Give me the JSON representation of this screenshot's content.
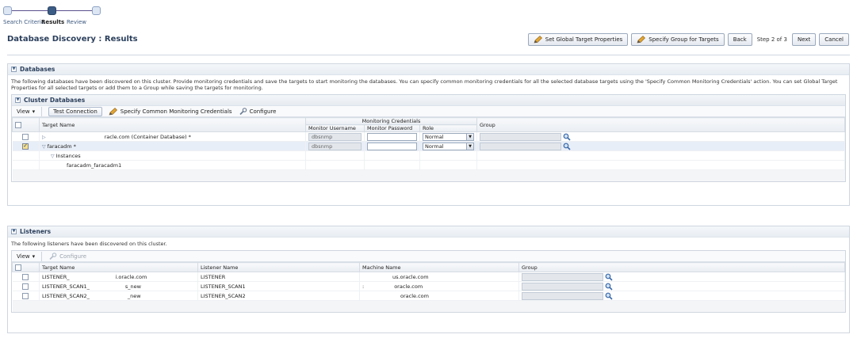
{
  "train": {
    "steps": [
      "Search Criteria",
      "Results",
      "Review"
    ]
  },
  "page": {
    "title": "Database Discovery : Results"
  },
  "actions": {
    "set_global": "Set Global Target Properties",
    "specify_group": "Specify Group for Targets",
    "back": "Back",
    "step": "Step 2 of 3",
    "next": "Next",
    "cancel": "Cancel"
  },
  "databases": {
    "header": "Databases",
    "description": "The following databases have been discovered on this cluster. Provide monitoring credentials and save the targets to start monitoring the databases. You can specify common monitoring credentials for all the selected database targets using the 'Specify Common Monitoring Credentials' action. You can set Global Target Properties for all selected targets or add them to a Group while saving the targets for monitoring.",
    "cluster": {
      "header": "Cluster Databases",
      "toolbar": {
        "view": "View",
        "test_connection": "Test Connection",
        "specify_common": "Specify Common Monitoring Credentials",
        "configure": "Configure"
      },
      "columns": {
        "target": "Target Name",
        "credentials": "Monitoring Credentials",
        "username": "Monitor Username",
        "password": "Monitor Password",
        "role": "Role",
        "group": "Group"
      },
      "rows": [
        {
          "target": "racle.com (Container Database) *",
          "username": "dbsnmp",
          "role": "Normal"
        },
        {
          "target": "faracadm *",
          "username": "dbsnmp",
          "role": "Normal"
        }
      ],
      "instances_label": "Instances",
      "instance": "faracadm_faracadm1"
    }
  },
  "listeners": {
    "header": "Listeners",
    "description": "The following listeners have been discovered on this cluster.",
    "toolbar": {
      "view": "View",
      "configure": "Configure"
    },
    "columns": {
      "target": "Target Name",
      "listener": "Listener Name",
      "machine": "Machine Name",
      "group": "Group"
    },
    "rows": [
      {
        "target_a": "LISTENER_",
        "target_b": "i.oracle.com",
        "listener": "LISTENER",
        "machine_a": "",
        "machine_b": "us.oracle.com"
      },
      {
        "target_a": "LISTENER_SCAN1_",
        "target_b": "s_new",
        "listener": "LISTENER_SCAN1",
        "machine_a": ":",
        "machine_b": "oracle.com"
      },
      {
        "target_a": "LISTENER_SCAN2_",
        "target_b": "_new",
        "listener": "LISTENER_SCAN2",
        "machine_a": "",
        "machine_b": "oracle.com"
      }
    ]
  }
}
